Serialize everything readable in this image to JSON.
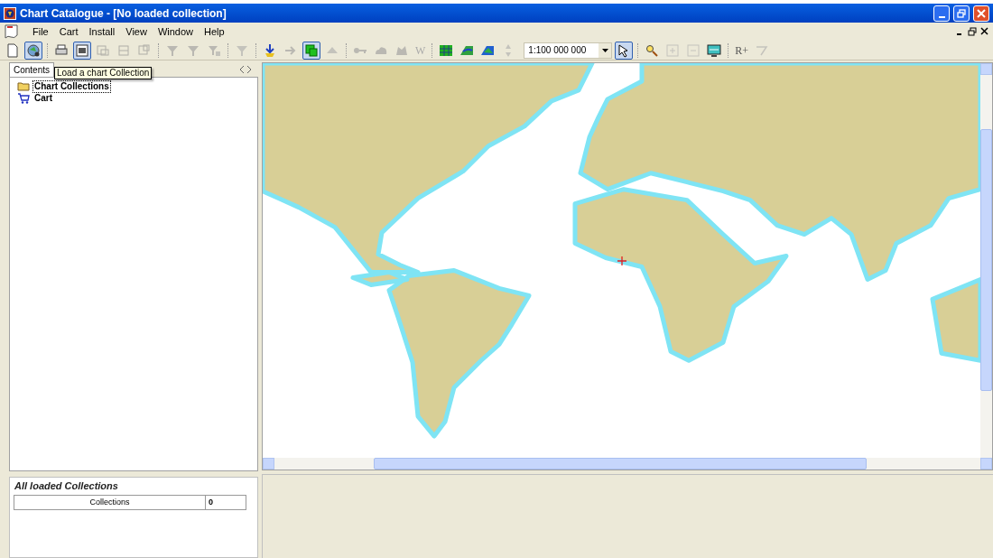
{
  "window": {
    "title": "Chart Catalogue - [No loaded collection]"
  },
  "menu": [
    "File",
    "Cart",
    "Install",
    "View",
    "Window",
    "Help"
  ],
  "toolbar": [
    {
      "kind": "button",
      "pressed": false,
      "disabled": false
    },
    {
      "kind": "button",
      "pressed": true,
      "disabled": false
    },
    {
      "kind": "separator"
    },
    {
      "kind": "button",
      "pressed": false,
      "disabled": false
    },
    {
      "kind": "button",
      "pressed": true,
      "disabled": false
    },
    {
      "kind": "button",
      "pressed": false,
      "disabled": true
    },
    {
      "kind": "button",
      "pressed": false,
      "disabled": true
    },
    {
      "kind": "button",
      "pressed": false,
      "disabled": true
    },
    {
      "kind": "separator"
    },
    {
      "kind": "button",
      "pressed": false,
      "disabled": true
    },
    {
      "kind": "button",
      "pressed": false,
      "disabled": true
    },
    {
      "kind": "button",
      "pressed": false,
      "disabled": true
    },
    {
      "kind": "separator"
    },
    {
      "kind": "button",
      "pressed": false,
      "disabled": true
    },
    {
      "kind": "separator"
    },
    {
      "kind": "button",
      "pressed": false,
      "disabled": false
    },
    {
      "kind": "button",
      "pressed": false,
      "disabled": true
    },
    {
      "kind": "button",
      "pressed": true,
      "disabled": false
    },
    {
      "kind": "button",
      "pressed": false,
      "disabled": true
    },
    {
      "kind": "separator"
    },
    {
      "kind": "button",
      "pressed": false,
      "disabled": true
    },
    {
      "kind": "button",
      "pressed": false,
      "disabled": true
    },
    {
      "kind": "button",
      "pressed": false,
      "disabled": true
    },
    {
      "kind": "text",
      "label": "W",
      "disabled": true
    },
    {
      "kind": "separator"
    },
    {
      "kind": "button",
      "pressed": false,
      "disabled": false
    },
    {
      "kind": "button",
      "pressed": false,
      "disabled": false
    },
    {
      "kind": "button",
      "pressed": false,
      "disabled": false
    },
    {
      "kind": "button",
      "pressed": false,
      "disabled": true
    },
    {
      "kind": "combo",
      "value": "1:100 000 000"
    },
    {
      "kind": "button",
      "pressed": true,
      "disabled": false
    },
    {
      "kind": "separator"
    },
    {
      "kind": "button",
      "pressed": false,
      "disabled": false
    },
    {
      "kind": "button",
      "pressed": false,
      "disabled": true
    },
    {
      "kind": "button",
      "pressed": false,
      "disabled": true
    },
    {
      "kind": "button",
      "pressed": false,
      "disabled": false
    },
    {
      "kind": "separator"
    },
    {
      "kind": "text",
      "label": "R+",
      "disabled": false
    },
    {
      "kind": "button",
      "pressed": false,
      "disabled": true
    }
  ],
  "panel_tabs": [
    {
      "label": "Contents",
      "selected": true
    }
  ],
  "tooltip": "Load a chart Collection",
  "tree": [
    {
      "label": "Chart Collections",
      "selected": true
    },
    {
      "label": "Cart",
      "selected": false
    }
  ],
  "collections_panel": {
    "title": "All loaded Collections",
    "rows": [
      {
        "name": "Collections",
        "count": "0"
      }
    ]
  }
}
